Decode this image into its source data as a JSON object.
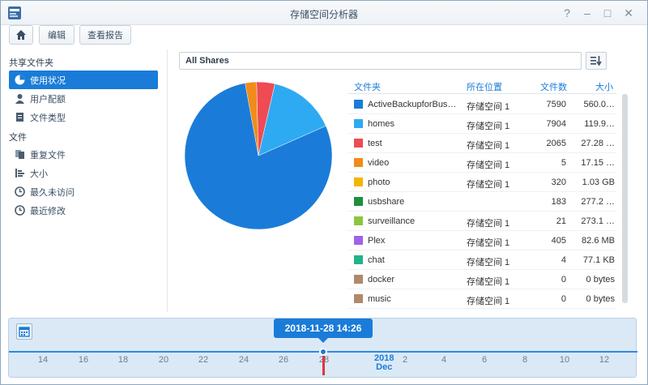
{
  "window": {
    "title": "存储空间分析器"
  },
  "window_controls": [
    "?",
    "–",
    "□",
    "✕"
  ],
  "toolbar": {
    "home_icon": "home-icon",
    "edit_label": "编辑",
    "report_label": "查看报告"
  },
  "sidebar": {
    "section1": "共享文件夹",
    "items1": [
      {
        "label": "使用状况",
        "icon": "pie-icon",
        "active": true
      },
      {
        "label": "用户配额",
        "icon": "user-icon"
      },
      {
        "label": "文件类型",
        "icon": "doc-icon"
      }
    ],
    "section2": "文件",
    "items2": [
      {
        "label": "重复文件",
        "icon": "copy-icon"
      },
      {
        "label": "大小",
        "icon": "bars-icon"
      },
      {
        "label": "最久未访问",
        "icon": "clock-icon"
      },
      {
        "label": "最近修改",
        "icon": "clock-icon"
      }
    ]
  },
  "filter": {
    "selected": "All Shares"
  },
  "table": {
    "headers": {
      "folder": "文件夹",
      "location": "所在位置",
      "count": "文件数",
      "size": "大小"
    },
    "rows": [
      {
        "color": "#1a7cd8",
        "name": "ActiveBackupforBus…",
        "location": "存储空间 1",
        "count": "7590",
        "size": "560.0…"
      },
      {
        "color": "#2eaaf2",
        "name": "homes",
        "location": "存储空间 1",
        "count": "7904",
        "size": "119.9…"
      },
      {
        "color": "#ee4b55",
        "name": "test",
        "location": "存储空间 1",
        "count": "2065",
        "size": "27.28 …"
      },
      {
        "color": "#f08c1a",
        "name": "video",
        "location": "存储空间 1",
        "count": "5",
        "size": "17.15 …"
      },
      {
        "color": "#f5b400",
        "name": "photo",
        "location": "存储空间 1",
        "count": "320",
        "size": "1.03 GB"
      },
      {
        "color": "#1e8f3a",
        "name": "usbshare",
        "location": "",
        "count": "183",
        "size": "277.2 …"
      },
      {
        "color": "#8cc63f",
        "name": "surveillance",
        "location": "存储空间 1",
        "count": "21",
        "size": "273.1 …"
      },
      {
        "color": "#a062e8",
        "name": "Plex",
        "location": "存储空间 1",
        "count": "405",
        "size": "82.6 MB"
      },
      {
        "color": "#22b38b",
        "name": "chat",
        "location": "存储空间 1",
        "count": "4",
        "size": "77.1 KB"
      },
      {
        "color": "#b0896a",
        "name": "docker",
        "location": "存储空间 1",
        "count": "0",
        "size": "0 bytes"
      },
      {
        "color": "#b0896a",
        "name": "music",
        "location": "存储空间 1",
        "count": "0",
        "size": "0 bytes"
      }
    ]
  },
  "pie_slices": [
    {
      "name": "ActiveBackupforBus…",
      "fraction": 0.816,
      "color": "#1a7cd8"
    },
    {
      "name": "homes",
      "fraction": 0.148,
      "color": "#2eaaf2"
    },
    {
      "name": "test",
      "fraction": 0.04,
      "color": "#ee4b55"
    },
    {
      "name": "video",
      "fraction": 0.025,
      "color": "#f08c1a"
    }
  ],
  "timeline": {
    "current": "2018-11-28 14:26",
    "year": "2018",
    "month": "Dec",
    "ticks": [
      "14",
      "16",
      "18",
      "20",
      "22",
      "24",
      "26",
      "28",
      "2",
      "4",
      "6",
      "8",
      "10",
      "12"
    ]
  }
}
